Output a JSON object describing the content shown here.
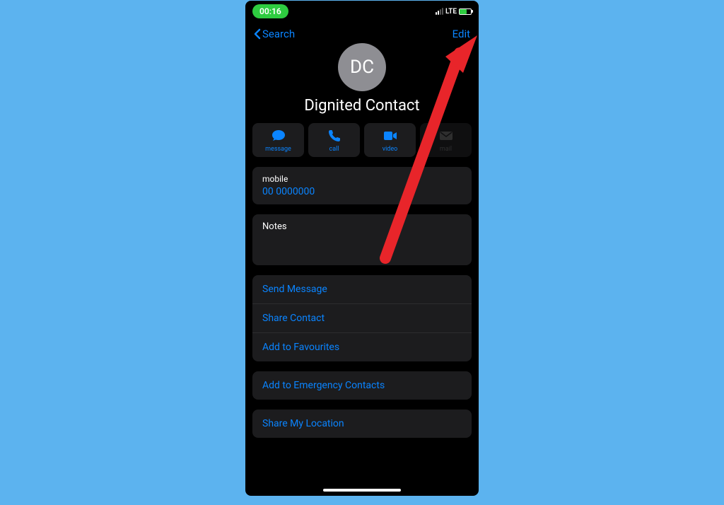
{
  "statusBar": {
    "time": "00:16",
    "network": "LTE"
  },
  "nav": {
    "back": "Search",
    "edit": "Edit"
  },
  "contact": {
    "initials": "DC",
    "name": "Dignited Contact"
  },
  "actions": {
    "message": "message",
    "call": "call",
    "video": "video",
    "mail": "mail"
  },
  "phone": {
    "label": "mobile",
    "number": "00 0000000"
  },
  "notes": {
    "label": "Notes"
  },
  "options": {
    "sendMessage": "Send Message",
    "shareContact": "Share Contact",
    "addFavourites": "Add to Favourites",
    "addEmergency": "Add to Emergency Contacts",
    "shareLocation": "Share My Location"
  }
}
